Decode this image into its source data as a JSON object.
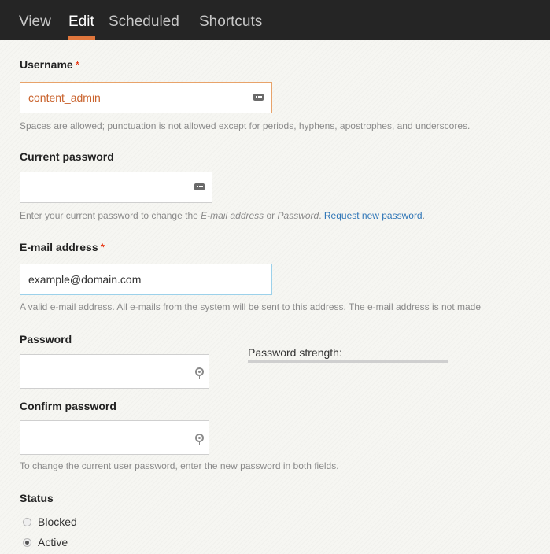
{
  "tabs": [
    {
      "label": "View"
    },
    {
      "label": "Edit",
      "active": true
    },
    {
      "label": "Scheduled"
    },
    {
      "label": "Shortcuts"
    }
  ],
  "username": {
    "label": "Username",
    "required_mark": "*",
    "value": "content_admin",
    "description": "Spaces are allowed; punctuation is not allowed except for periods, hyphens, apostrophes, and underscores."
  },
  "current_password": {
    "label": "Current password",
    "value": "",
    "desc_prefix": "Enter your current password to change the ",
    "desc_email": "E-mail address",
    "desc_or": " or ",
    "desc_password": "Password",
    "desc_period": ". ",
    "request_link": "Request new password",
    "desc_end": "."
  },
  "email": {
    "label": "E-mail address",
    "required_mark": "*",
    "value": "example@domain.com",
    "description": "A valid e-mail address. All e-mails from the system will be sent to this address. The e-mail address is not made"
  },
  "password": {
    "label": "Password",
    "value": "",
    "strength_label": "Password strength:"
  },
  "confirm_password": {
    "label": "Confirm password",
    "value": "",
    "description": "To change the current user password, enter the new password in both fields."
  },
  "status": {
    "label": "Status",
    "options": [
      {
        "label": "Blocked",
        "checked": false
      },
      {
        "label": "Active",
        "checked": true
      }
    ]
  },
  "colors": {
    "topbar": "#252525",
    "active_tab_underline": "#e0763c",
    "required": "#e62600",
    "link": "#2f76b7",
    "error_border": "#e8a36a"
  }
}
